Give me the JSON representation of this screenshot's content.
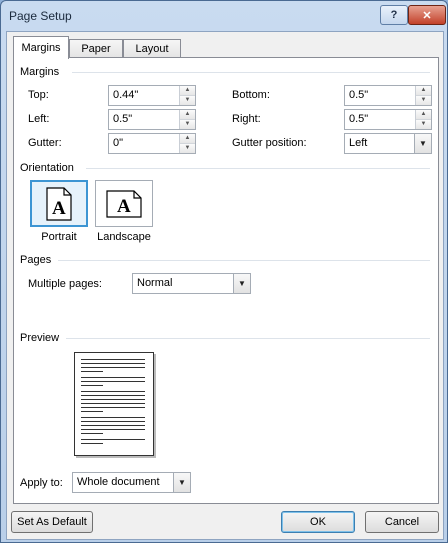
{
  "window": {
    "title": "Page Setup",
    "help_label": "?",
    "close_label": "✕"
  },
  "tabs": [
    {
      "label": "Margins",
      "active": true
    },
    {
      "label": "Paper",
      "active": false
    },
    {
      "label": "Layout",
      "active": false
    }
  ],
  "margins": {
    "section_label": "Margins",
    "top": {
      "label": "Top:",
      "value": "0.44\""
    },
    "left": {
      "label": "Left:",
      "value": "0.5\""
    },
    "gutter": {
      "label": "Gutter:",
      "value": "0\""
    },
    "bottom": {
      "label": "Bottom:",
      "value": "0.5\""
    },
    "right": {
      "label": "Right:",
      "value": "0.5\""
    },
    "gutter_position": {
      "label": "Gutter position:",
      "value": "Left"
    }
  },
  "orientation": {
    "section_label": "Orientation",
    "portrait_label": "Portrait",
    "landscape_label": "Landscape",
    "icon_glyph": "A",
    "selected": "Portrait"
  },
  "pages": {
    "section_label": "Pages",
    "multiple_pages_label": "Multiple pages:",
    "multiple_pages_value": "Normal"
  },
  "preview": {
    "section_label": "Preview"
  },
  "apply_to": {
    "label": "Apply to:",
    "value": "Whole document"
  },
  "buttons": {
    "set_default": "Set As Default",
    "ok": "OK",
    "cancel": "Cancel"
  },
  "icons": {
    "spin_up": "▲",
    "spin_down": "▼",
    "dropdown": "▼"
  },
  "colors": {
    "selection_border": "#3d95d3",
    "titlebar": "#c9dbf0",
    "close_button": "#c2412a"
  }
}
